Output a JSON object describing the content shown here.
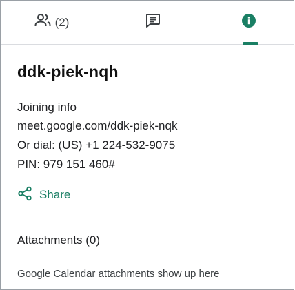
{
  "tabs": {
    "people": {
      "icon": "people-icon",
      "count_label": "(2)"
    },
    "chat": {
      "icon": "chat-icon"
    },
    "info": {
      "icon": "info-icon",
      "active": true
    }
  },
  "meeting": {
    "title": "ddk-piek-nqh"
  },
  "joining_info": {
    "label": "Joining info",
    "url": "meet.google.com/ddk-piek-nqk",
    "dial": "Or dial: (US) +1 224-532-9075",
    "pin": "PIN: 979 151 460#"
  },
  "share": {
    "icon": "share-icon",
    "label": "Share"
  },
  "attachments": {
    "label": "Attachments (0)",
    "hint": "Google Calendar attachments show up here"
  },
  "colors": {
    "accent": "#1a7f64",
    "text": "#202124",
    "divider": "#dadce0"
  }
}
